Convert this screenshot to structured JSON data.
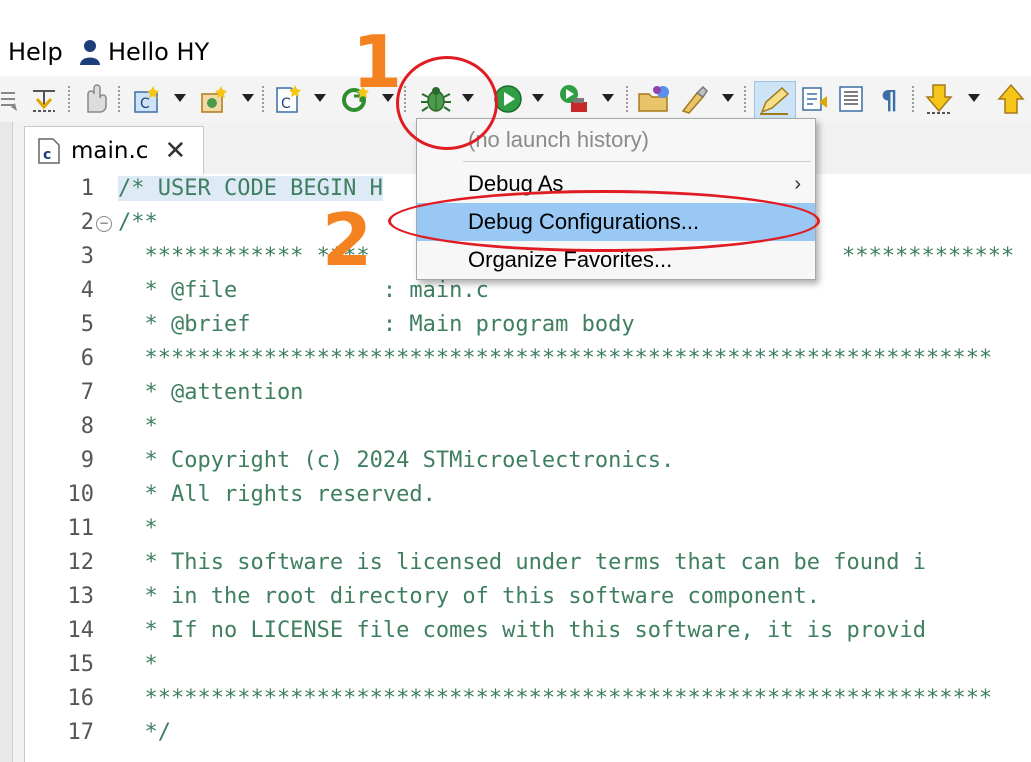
{
  "menubar": {
    "help_label": "Help",
    "user_label": "Hello HY"
  },
  "toolbar": {
    "icons": [
      "skip-all-breakpoints-icon",
      "step-filters-icon",
      "hand-icon",
      "new-c-project-icon",
      "new-c-class-icon",
      "new-c-file-icon",
      "build-icon",
      "debug-icon",
      "run-icon",
      "external-tools-icon",
      "open-folder-icon",
      "search-icon",
      "highlight-icon",
      "toggle-mark-occurrences-icon",
      "block-select-icon",
      "show-whitespace-icon",
      "next-annotation-icon",
      "previous-annotation-icon"
    ]
  },
  "tab": {
    "filename": "main.c",
    "close_glyph": "✕"
  },
  "editor": {
    "lines": [
      {
        "n": "1",
        "text": "/* USER CODE BEGIN H"
      },
      {
        "n": "2",
        "text": "/**"
      },
      {
        "n": "3",
        "text": "  ************ ****"
      },
      {
        "n": "4",
        "text": "  * @file           : main.c"
      },
      {
        "n": "5",
        "text": "  * @brief          : Main program body"
      },
      {
        "n": "6",
        "text": "  ****************************************************************"
      },
      {
        "n": "7",
        "text": "  * @attention"
      },
      {
        "n": "8",
        "text": "  *"
      },
      {
        "n": "9",
        "text": "  * Copyright (c) 2024 STMicroelectronics."
      },
      {
        "n": "10",
        "text": "  * All rights reserved."
      },
      {
        "n": "11",
        "text": "  *"
      },
      {
        "n": "12",
        "text": "  * This software is licensed under terms that can be found i"
      },
      {
        "n": "13",
        "text": "  * in the root directory of this software component."
      },
      {
        "n": "14",
        "text": "  * If no LICENSE file comes with this software, it is provid"
      },
      {
        "n": "15",
        "text": "  *"
      },
      {
        "n": "16",
        "text": "  ****************************************************************"
      },
      {
        "n": "17",
        "text": "  */"
      }
    ],
    "line3_tail": "*************"
  },
  "dropdown": {
    "items": [
      {
        "label": "(no launch history)",
        "state": "disabled"
      },
      {
        "label": "Debug As",
        "state": "submenu"
      },
      {
        "label": "Debug Configurations...",
        "state": "selected"
      },
      {
        "label": "Organize Favorites...",
        "state": "normal"
      }
    ],
    "submenu_arrow": "›"
  },
  "annotations": {
    "step1": "1",
    "step2": "2",
    "number_color": "#f58220",
    "ellipse_color": "#e11b22"
  },
  "colors": {
    "comment": "#3f7f5f",
    "selection": "#99c8f5",
    "highlight_line": "#dfeaf7"
  }
}
